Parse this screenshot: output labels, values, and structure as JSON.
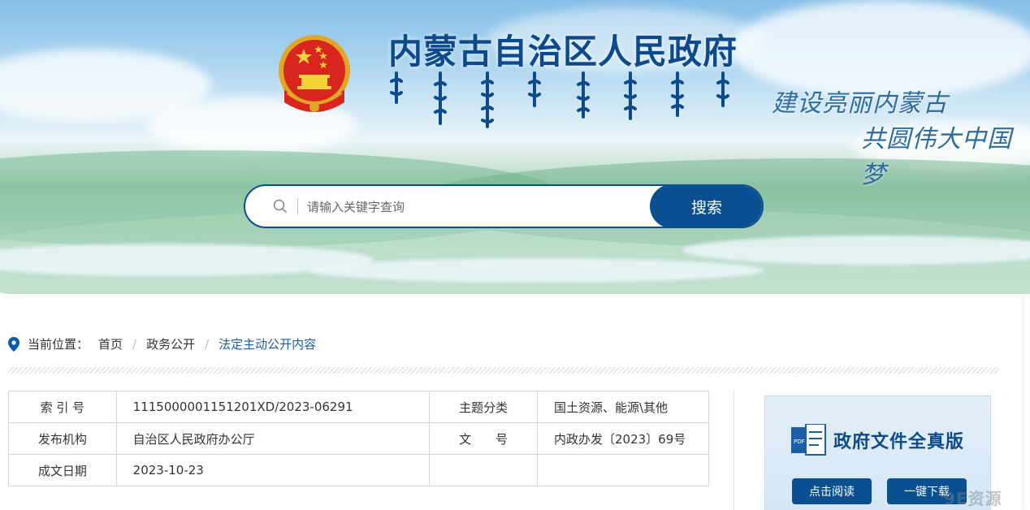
{
  "header": {
    "site_title": "内蒙古自治区人民政府",
    "slogan_line1": "建设亮丽内蒙古",
    "slogan_line2": "共圆伟大中国梦"
  },
  "search": {
    "placeholder": "请输入关键字查询",
    "button_label": "搜索"
  },
  "breadcrumb": {
    "prefix": "当前位置：",
    "items": [
      "首页",
      "政务公开",
      "法定主动公开内容"
    ],
    "separator": "/"
  },
  "metadata": {
    "rows": [
      {
        "label1": "索 引 号",
        "value1": "11150000011512 01XD/2023-06291",
        "label2": "主题分类",
        "value2": "国土资源、能源\\其他"
      },
      {
        "label1": "发布机构",
        "value1": "自治区人民政府办公厅",
        "label2": "文　　号",
        "value2": "内政办发〔2023〕69号"
      },
      {
        "label1": "成文日期",
        "value1": "2023-10-23",
        "label2": "",
        "value2": ""
      }
    ]
  },
  "full_text_panel": {
    "title": "政府文件全真版",
    "pdf_label": "PDF",
    "read_button": "点击阅读",
    "download_button": "一键下载"
  },
  "watermark": "9E资源",
  "colors": {
    "primary": "#0a4f8f",
    "title": "#0c4a8c",
    "link_current": "#1a5ea6"
  }
}
